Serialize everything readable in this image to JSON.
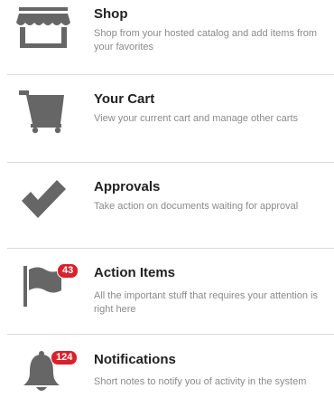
{
  "menu": {
    "items": [
      {
        "title": "Shop",
        "description": "Shop from your hosted catalog and add items from your favorites",
        "icon": "storefront-icon"
      },
      {
        "title": "Your Cart",
        "description": "View your current cart and manage other carts",
        "icon": "cart-icon"
      },
      {
        "title": "Approvals",
        "description": "Take action on documents waiting for approval",
        "icon": "checkmark-icon"
      },
      {
        "title": "Action Items",
        "description": "All the important stuff that requires your attention is right here",
        "icon": "flag-icon",
        "badge": "43"
      },
      {
        "title": "Notifications",
        "description": "Short notes to notify you of activity in the system",
        "icon": "bell-icon",
        "badge": "124"
      }
    ]
  },
  "colors": {
    "icon": "#666666",
    "badge": "#d9212c",
    "description": "#8a8a8a",
    "divider": "#dcdcdc"
  }
}
